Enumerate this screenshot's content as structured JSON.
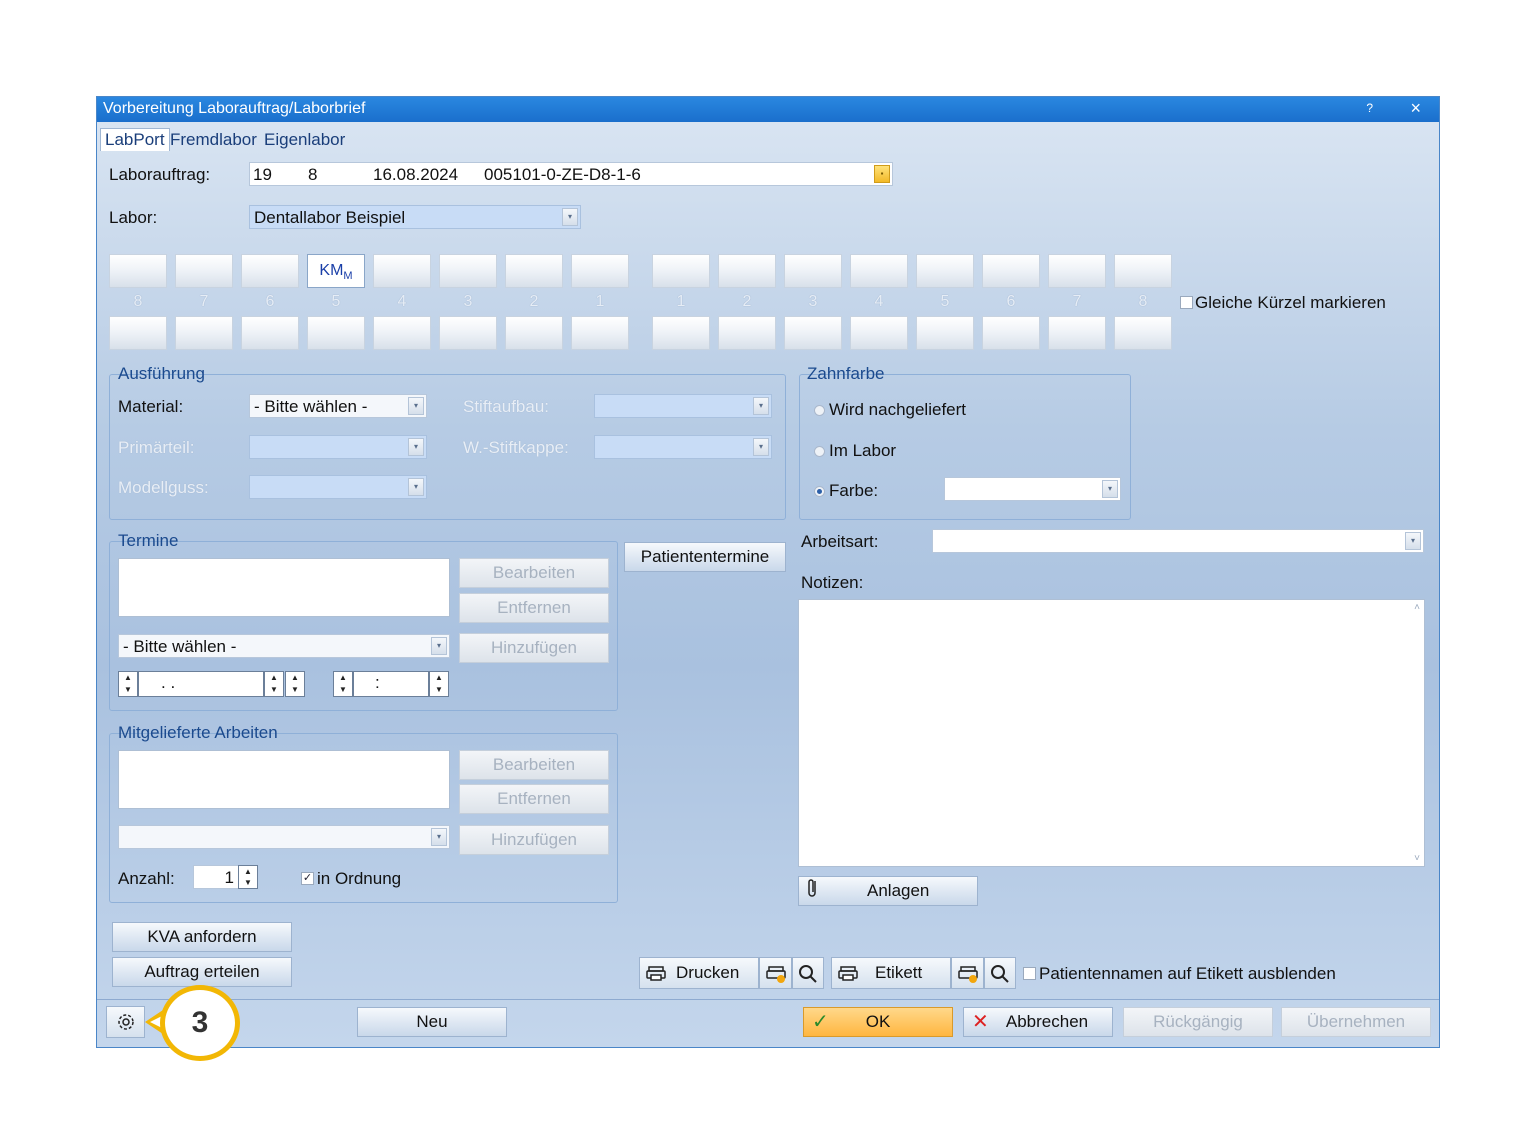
{
  "window": {
    "title": "Vorbereitung Laborauftrag/Laborbrief",
    "help": "?",
    "close": "×"
  },
  "tabs": [
    "LabPort",
    "Fremdlabor",
    "Eigenlabor"
  ],
  "laborauftrag": {
    "label": "Laborauftrag:",
    "nr": "19",
    "sub": "8",
    "date": "16.08.2024",
    "code": "005101-0-ZE-D8-1-6"
  },
  "labor": {
    "label": "Labor:",
    "value": "Dentallabor Beispiel"
  },
  "teeth": {
    "left_numbers": [
      "8",
      "7",
      "6",
      "5",
      "4",
      "3",
      "2",
      "1"
    ],
    "right_numbers": [
      "1",
      "2",
      "3",
      "4",
      "5",
      "6",
      "7",
      "8"
    ],
    "selected_main": "KM",
    "selected_sub": "M",
    "gleiche_label": "Gleiche Kürzel markieren"
  },
  "ausfuehrung": {
    "title": "Ausführung",
    "material_label": "Material:",
    "material_value": "- Bitte wählen -",
    "primaerteil_label": "Primärteil:",
    "modellguss_label": "Modellguss:",
    "stiftaufbau_label": "Stiftaufbau:",
    "stiftkappe_label": "W.-Stiftkappe:"
  },
  "zahnfarbe": {
    "title": "Zahnfarbe",
    "opt1": "Wird nachgeliefert",
    "opt2": "Im Labor",
    "opt3": "Farbe:"
  },
  "termine": {
    "title": "Termine",
    "bearbeiten": "Bearbeiten",
    "entfernen": "Entfernen",
    "hinzufuegen": "Hinzufügen",
    "select_value": "- Bitte wählen -",
    "date_value": ".   .",
    "time_value": ":",
    "patiententermine": "Patiententermine"
  },
  "arbeitsart": {
    "label": "Arbeitsart:"
  },
  "notizen": {
    "label": "Notizen:"
  },
  "anlagen": "Anlagen",
  "mitgelieferte": {
    "title": "Mitgelieferte Arbeiten",
    "bearbeiten": "Bearbeiten",
    "entfernen": "Entfernen",
    "hinzufuegen": "Hinzufügen",
    "anzahl_label": "Anzahl:",
    "anzahl_value": "1",
    "ordnung_label": "in Ordnung"
  },
  "buttons": {
    "kva": "KVA anfordern",
    "auftrag": "Auftrag erteilen",
    "drucken": "Drucken",
    "etikett": "Etikett",
    "patientennamen": "Patientennamen auf Etikett ausblenden",
    "neu": "Neu",
    "ok": "OK",
    "abbrechen": "Abbrechen",
    "rueckgaengig": "Rückgängig",
    "uebernehmen": "Übernehmen"
  },
  "callout": "3"
}
